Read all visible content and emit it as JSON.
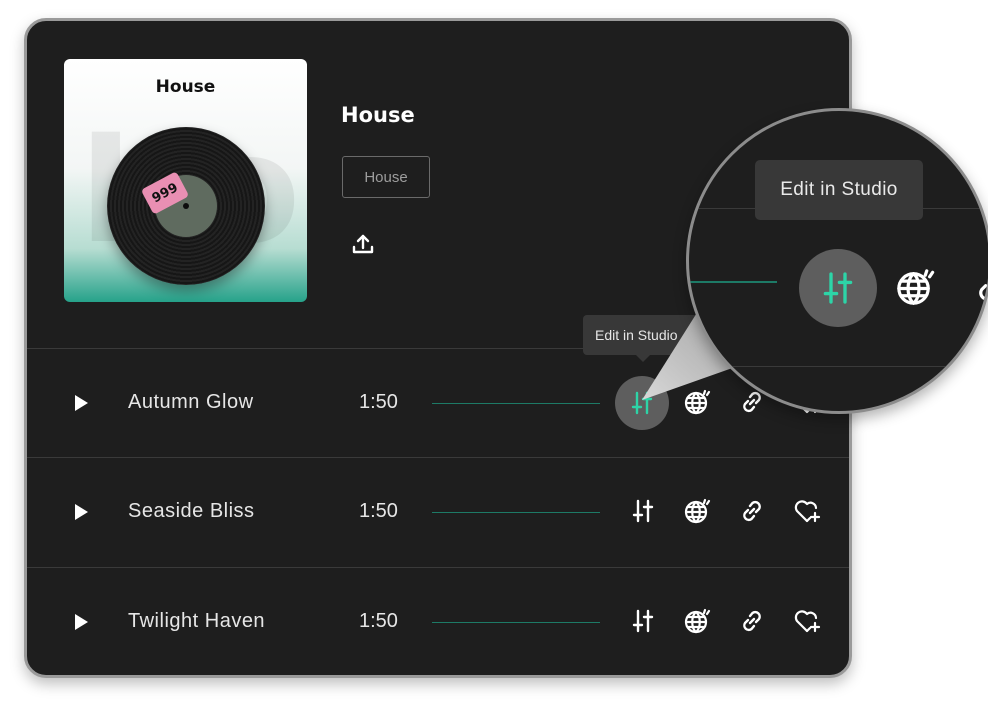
{
  "album": {
    "title": "House",
    "cover_title": "House",
    "cover_sticker": "999",
    "genre_tag": "House"
  },
  "tooltip": {
    "label": "Edit in Studio"
  },
  "tracks": [
    {
      "name": "Autumn Glow",
      "duration": "1:50"
    },
    {
      "name": "Seaside Bliss",
      "duration": "1:50"
    },
    {
      "name": "Twilight Haven",
      "duration": "1:50"
    }
  ],
  "icons": {
    "upload": "upload-icon",
    "play": "play-icon",
    "studio": "sliders-icon",
    "globe": "globe-icon",
    "link": "link-icon",
    "favorite": "heart-plus-icon"
  },
  "colors": {
    "panel": "#1e1e1e",
    "accent": "#2dd4a7",
    "waveform": "#1d7a66",
    "tooltip": "#383838"
  }
}
